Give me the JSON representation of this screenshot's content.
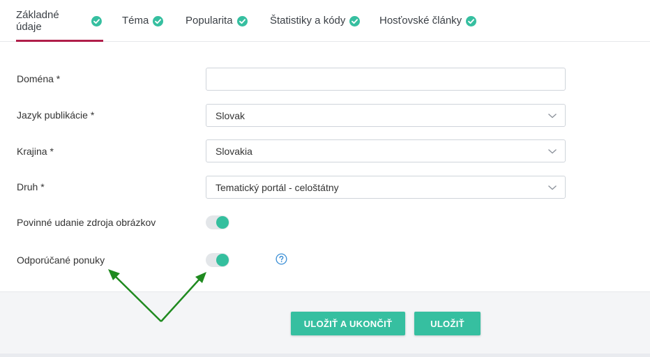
{
  "tabs": [
    {
      "label": "Základné údaje",
      "active": true
    },
    {
      "label": "Téma",
      "active": false
    },
    {
      "label": "Popularita",
      "active": false
    },
    {
      "label": "Štatistiky a kódy",
      "active": false
    },
    {
      "label": "Hosťovské články",
      "active": false
    }
  ],
  "form": {
    "domain": {
      "label": "Doména *",
      "value": ""
    },
    "language": {
      "label": "Jazyk publikácie *",
      "value": "Slovak"
    },
    "country": {
      "label": "Krajina *",
      "value": "Slovakia"
    },
    "type": {
      "label": "Druh *",
      "value": "Tematický portál - celoštátny"
    },
    "image_source": {
      "label": "Povinné udanie zdroja obrázkov",
      "on": true
    },
    "recommended": {
      "label": "Odporúčané ponuky",
      "on": true
    }
  },
  "buttons": {
    "save_exit": "ULOŽIŤ A UKONČIŤ",
    "save": "ULOŽIŤ"
  },
  "colors": {
    "accent": "#36bfa0",
    "tab_underline": "#b01e4a",
    "annotation_arrow": "#1f8a1f"
  },
  "icons": {
    "tab_status": "check-circle-icon",
    "select": "chevron-down-icon",
    "help": "question-circle-icon"
  }
}
